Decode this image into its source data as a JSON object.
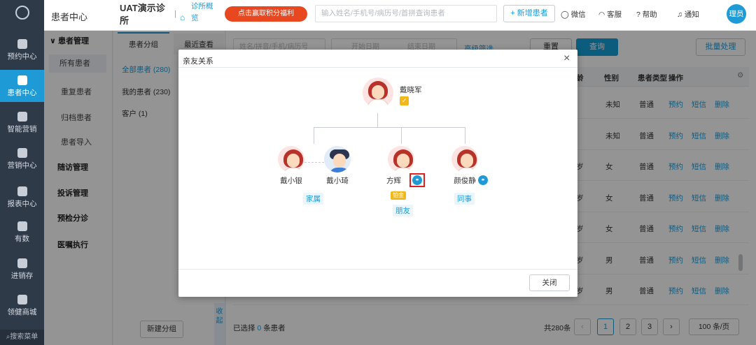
{
  "nav": {
    "items": [
      {
        "label": "预约中心",
        "icon": "calendar-icon"
      },
      {
        "label": "患者中心",
        "icon": "user-icon"
      },
      {
        "label": "智能营销",
        "icon": "bulb-icon"
      },
      {
        "label": "营销中心",
        "icon": "fan-icon"
      },
      {
        "label": "报表中心",
        "icon": "bar-chart-icon"
      },
      {
        "label": "有数",
        "icon": "line-chart-icon"
      },
      {
        "label": "进销存",
        "icon": "layers-icon"
      },
      {
        "label": "领健商城",
        "icon": "shop-icon"
      }
    ],
    "search_menu": "搜索菜单",
    "active_color": "#1e9bd7"
  },
  "header": {
    "module": "患者中心",
    "clinic": "UAT演示诊所",
    "overview": "诊所概览",
    "promo": "点击赢取积分福利",
    "search_placeholder": "输入姓名/手机号/病历号/首拼查询患者",
    "add_patient": "+ 新增患者",
    "wechat": "微信",
    "service": "客服",
    "help": "帮助",
    "notice": "通知",
    "user": "理员"
  },
  "submenu": {
    "patient_mgmt": "患者管理",
    "items": [
      "所有患者",
      "重复患者",
      "归档患者",
      "患者导入"
    ],
    "groups": [
      "随访管理",
      "投诉管理",
      "预检分诊",
      "医嘱执行"
    ]
  },
  "group_panel": {
    "tabs": [
      "患者分组",
      "最近查看"
    ],
    "groups": [
      {
        "label": "全部患者",
        "count": "(280)"
      },
      {
        "label": "我的患者",
        "count": "(230)"
      },
      {
        "label": "客户",
        "count": "(1)"
      }
    ],
    "new_group": "新建分组",
    "collapse": "收起"
  },
  "main": {
    "filter_placeholder": "姓名/拼音/手机/病历号",
    "start_date": "开始日期",
    "end_date": "结束日期",
    "advanced": "高级筛选",
    "reset": "重置",
    "query": "查询",
    "batch": "批量处理",
    "columns": [
      "龄",
      "性别",
      "患者类型",
      "操作"
    ],
    "rows": [
      {
        "age": "",
        "gender": "未知",
        "type": "普通"
      },
      {
        "age": "",
        "gender": "未知",
        "type": "普通"
      },
      {
        "age": "岁",
        "gender": "女",
        "type": "普通"
      },
      {
        "age": "岁",
        "gender": "女",
        "type": "普通"
      },
      {
        "age": "岁",
        "gender": "女",
        "type": "普通"
      },
      {
        "age": "岁",
        "gender": "男",
        "type": "普通"
      },
      {
        "age": "岁",
        "gender": "男",
        "type": "普通"
      }
    ],
    "actions": [
      "预约",
      "短信",
      "删除"
    ],
    "selected_prefix": "已选择",
    "selected_count": "0",
    "selected_suffix": "条患者",
    "total": "共280条",
    "pages": [
      "1",
      "2",
      "3"
    ],
    "page_size": "100 条/页"
  },
  "modal": {
    "title": "亲友关系",
    "root": {
      "name": "戴晓军"
    },
    "people": [
      {
        "name": "戴小银"
      },
      {
        "name": "戴小琦"
      },
      {
        "name": "方辉",
        "vip": "铂金"
      },
      {
        "name": "颜俊静"
      }
    ],
    "relations": [
      "家属",
      "朋友",
      "同事"
    ],
    "close": "关闭"
  }
}
